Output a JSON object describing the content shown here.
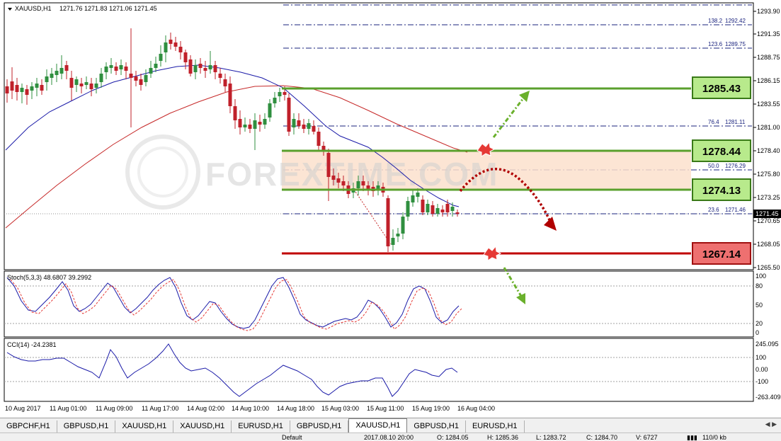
{
  "chart_header": {
    "symbol_label": "XAUUSD,H1",
    "ohlc_label": "1271.76 1271.83 1271.06 1271.45"
  },
  "price_axis": {
    "ticks": [
      "1293.90",
      "1291.35",
      "1288.75",
      "1286.15",
      "1283.55",
      "1281.00",
      "1278.40",
      "1275.80",
      "1273.25",
      "1270.65",
      "1268.05",
      "1265.50"
    ],
    "current_price": "1271.45"
  },
  "fibonacci_levels": [
    {
      "label": "138.2",
      "price": "1292.42"
    },
    {
      "label": "123.6",
      "price": "1289.75"
    },
    {
      "label": "76.4",
      "price": "1281.11"
    },
    {
      "label": "50.0",
      "price": "1276.29"
    },
    {
      "label": "23.6",
      "price": "1271.46"
    }
  ],
  "level_boxes": [
    {
      "label": "1285.43",
      "kind": "resistance"
    },
    {
      "label": "1278.44",
      "kind": "resistance"
    },
    {
      "label": "1274.13",
      "kind": "support"
    },
    {
      "label": "1267.14",
      "kind": "support-strong"
    }
  ],
  "watermark": "FOREXTIME.COM",
  "stochastic": {
    "label": "Stoch(5,3,3) 48.6807 39.2992",
    "ticks": [
      "100",
      "80",
      "50",
      "20",
      "0"
    ]
  },
  "cci": {
    "label": "CCI(14) -24.2381",
    "ticks": [
      "245.095",
      "100",
      "0.00",
      "-100",
      "-263.409"
    ]
  },
  "time_axis": [
    "10 Aug 2017",
    "11 Aug 01:00",
    "11 Aug 09:00",
    "11 Aug 17:00",
    "14 Aug 02:00",
    "14 Aug 10:00",
    "14 Aug 18:00",
    "15 Aug 03:00",
    "15 Aug 11:00",
    "15 Aug 19:00",
    "16 Aug 04:00"
  ],
  "tabs": [
    "GBPCHF,H1",
    "GBPUSD,H1",
    "XAUUSD,H1",
    "XAUUSD,H1",
    "EURUSD,H1",
    "GBPUSD,H1",
    "XAUUSD,H1",
    "GBPUSD,H1",
    "EURUSD,H1"
  ],
  "active_tab_index": 6,
  "status_bar": {
    "profile": "Default",
    "datetime": "2017.08.10 20:00",
    "open": "O: 1284.05",
    "high": "H: 1285.36",
    "low": "L: 1283.72",
    "close": "C: 1284.70",
    "volume": "V: 6727",
    "traffic": "110/0 kb"
  },
  "colors": {
    "bull_candle": "#2f8f3f",
    "bear_candle": "#c0202a",
    "ma_fast": "#1a1aa8",
    "ma_slow": "#c62828",
    "green_level": "#5aa02c",
    "red_level": "#c00000",
    "box_green": "#b8ea8c",
    "box_red": "#ee7070",
    "zone_fill": "#fbe0cc",
    "fib_line": "#1a237e"
  }
}
